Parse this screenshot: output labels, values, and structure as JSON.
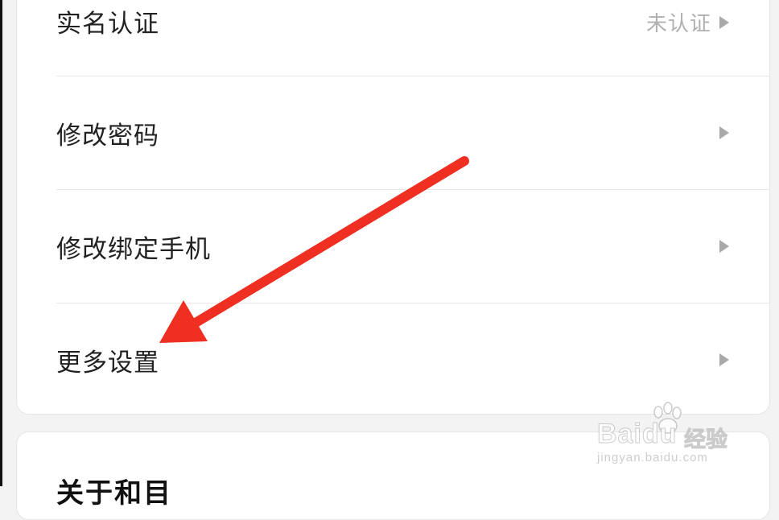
{
  "settings": {
    "rows": [
      {
        "label": "实名认证",
        "value": "未认证"
      },
      {
        "label": "修改密码",
        "value": ""
      },
      {
        "label": "修改绑定手机",
        "value": ""
      },
      {
        "label": "更多设置",
        "value": ""
      }
    ]
  },
  "about_section": {
    "title": "关于和目"
  },
  "annotation": {
    "arrow_color": "#ee2f22"
  },
  "watermark": {
    "brand": "Baidu",
    "brand_cn": "经验",
    "url": "jingyan.baidu.com"
  },
  "icons": {
    "chevron": "chevron-right-icon",
    "paw": "baidu-paw-icon"
  }
}
